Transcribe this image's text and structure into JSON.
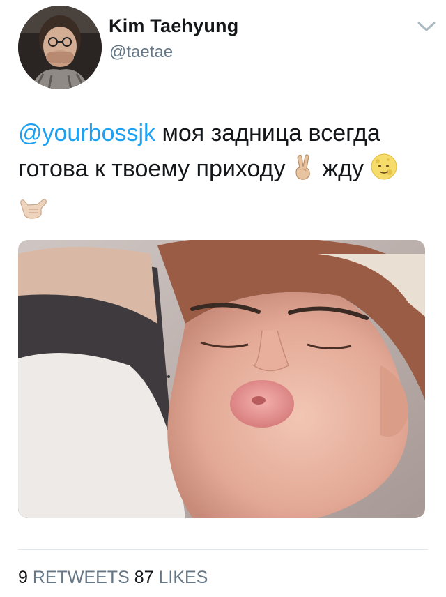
{
  "tweet": {
    "author": {
      "display_name": "Kim Taehyung",
      "handle": "@taetae"
    },
    "text": {
      "mention": "@yourbossjk",
      "line1_rest": " моя задница всегда",
      "line2": "готова к твоему приходу ",
      "word_after_emoji": " жду "
    },
    "emojis": [
      "victory-hand-emoji",
      "slightly-smiling-moon-face-emoji",
      "call-me-hand-emoji"
    ],
    "stats": {
      "retweets_count": "9",
      "retweets_label": "RETWEETS",
      "likes_count": "87",
      "likes_label": "LIKES"
    },
    "colors": {
      "mention": "#1da1f2",
      "secondary_text": "#657786",
      "primary_text": "#14171a",
      "divider": "#e1e8ed"
    }
  }
}
